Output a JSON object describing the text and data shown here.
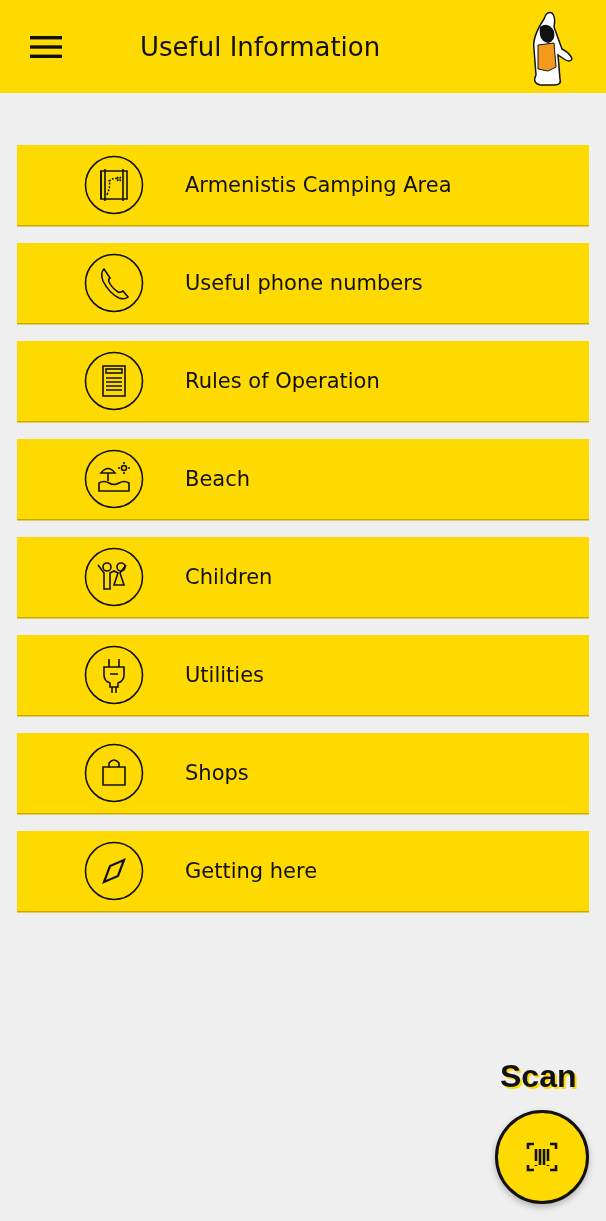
{
  "app_bar": {
    "title": "Useful Information"
  },
  "items": [
    {
      "label": "Armenistis Camping Area",
      "kind": "map"
    },
    {
      "label": "Useful phone numbers",
      "kind": "phone"
    },
    {
      "label": "Rules of Operation",
      "kind": "document"
    },
    {
      "label": "Beach",
      "kind": "beach"
    },
    {
      "label": "Children",
      "kind": "children"
    },
    {
      "label": "Utilities",
      "kind": "plug"
    },
    {
      "label": "Shops",
      "kind": "bag"
    },
    {
      "label": "Getting here",
      "kind": "compass"
    }
  ],
  "scan": {
    "label": "Scan"
  }
}
